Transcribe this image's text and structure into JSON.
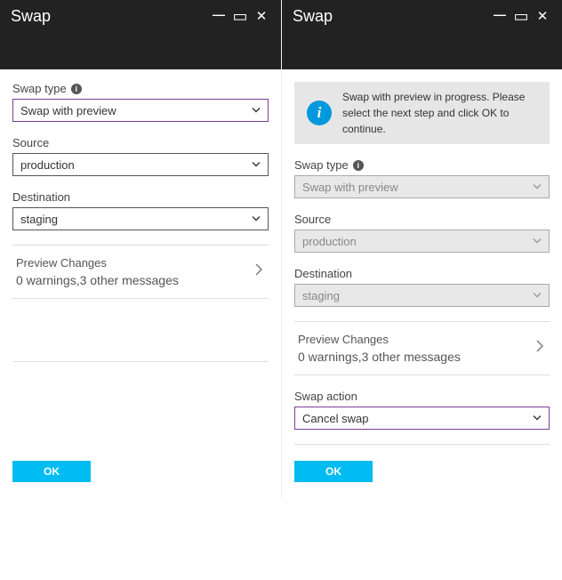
{
  "left": {
    "title": "Swap",
    "swapTypeLabel": "Swap type",
    "swapTypeValue": "Swap with preview",
    "sourceLabel": "Source",
    "sourceValue": "production",
    "destinationLabel": "Destination",
    "destinationValue": "staging",
    "previewTitle": "Preview Changes",
    "previewSummary": "0 warnings,3 other messages",
    "okLabel": "OK"
  },
  "right": {
    "title": "Swap",
    "bannerText": "Swap with preview in progress. Please select the next step and click OK to continue.",
    "swapTypeLabel": "Swap type",
    "swapTypeValue": "Swap with preview",
    "sourceLabel": "Source",
    "sourceValue": "production",
    "destinationLabel": "Destination",
    "destinationValue": "staging",
    "previewTitle": "Preview Changes",
    "previewSummary": "0 warnings,3 other messages",
    "swapActionLabel": "Swap action",
    "swapActionValue": "Cancel swap",
    "okLabel": "OK"
  }
}
